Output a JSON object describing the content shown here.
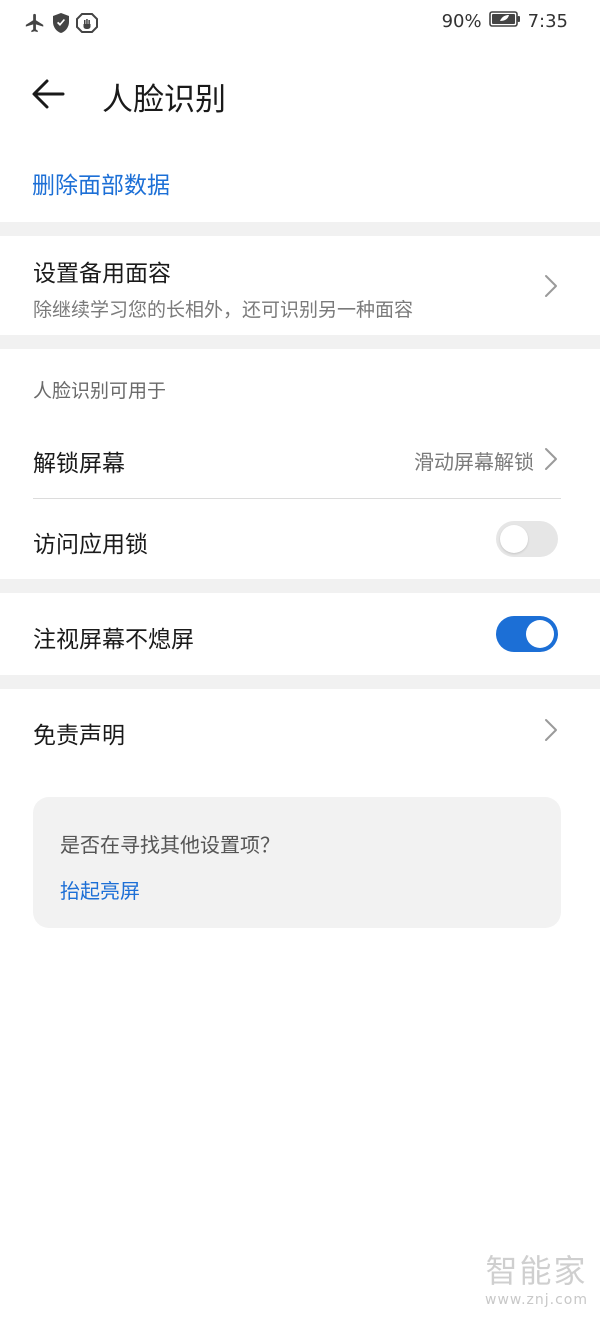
{
  "status_bar": {
    "battery": "90%",
    "time": "7:35",
    "icons": [
      "airplane-icon",
      "shield-icon",
      "hand-icon",
      "battery-icon"
    ]
  },
  "header": {
    "title": "人脸识别"
  },
  "actions": {
    "delete_face_data": "删除面部数据"
  },
  "backup_face": {
    "title": "设置备用面容",
    "subtitle": "除继续学习您的长相外，还可识别另一种面容"
  },
  "usage_section": {
    "header": "人脸识别可用于",
    "unlock_screen": {
      "title": "解锁屏幕",
      "value": "滑动屏幕解锁"
    },
    "app_lock": {
      "title": "访问应用锁",
      "enabled": false
    }
  },
  "gaze": {
    "title": "注视屏幕不熄屏",
    "enabled": true
  },
  "disclaimer": {
    "title": "免责声明"
  },
  "suggestions": {
    "question": "是否在寻找其他设置项？",
    "link": "抬起亮屏"
  },
  "watermark": {
    "logo": "智能家",
    "url": "www.znj.com"
  },
  "colors": {
    "accent": "#1c6fd6",
    "band": "#f1f1f1",
    "toggle_off": "#e6e6e6"
  }
}
